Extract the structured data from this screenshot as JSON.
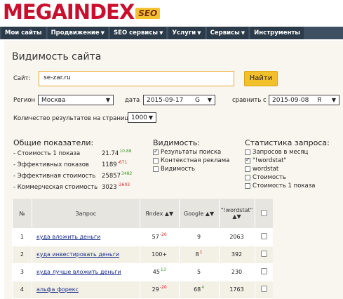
{
  "logo": {
    "text": "MEGAINDEX",
    "badge": "SEO"
  },
  "nav": [
    {
      "label": "Мои сайты",
      "dropdown": false
    },
    {
      "label": "Продвижение",
      "dropdown": true
    },
    {
      "label": "SEO сервисы",
      "dropdown": true
    },
    {
      "label": "Услуги",
      "dropdown": true
    },
    {
      "label": "Сервисы",
      "dropdown": true
    },
    {
      "label": "Инструменты",
      "dropdown": false
    }
  ],
  "page_title": "Видимость сайта",
  "form": {
    "site_label": "Сайт:",
    "site_value": "se-zar.ru",
    "find_button": "Найти",
    "region_label": "Регион",
    "region_value": "Москва",
    "date_label": "дата",
    "date_value": "2015-09-17",
    "date_engine": "G",
    "compare_label": "сравнить с",
    "compare_value": "2015-09-08",
    "compare_engine": "Я",
    "results_label": "Количество результатов на страницу",
    "results_value": "1000"
  },
  "overall": {
    "title": "Общие показатели:",
    "rows": [
      {
        "label": "- Стоимость 1 показа",
        "value": "21.74",
        "delta": "10.88",
        "dir": "up"
      },
      {
        "label": "- Эффективных показов",
        "value": "1189",
        "delta": "-671",
        "dir": "down"
      },
      {
        "label": "- Эффективная стоимость",
        "value": "25857",
        "delta": "3482",
        "dir": "up"
      },
      {
        "label": "- Коммерческая стоимость",
        "value": "3023",
        "delta": "-2603",
        "dir": "down"
      }
    ]
  },
  "visibility": {
    "title": "Видимость:",
    "options": [
      {
        "label": "Результаты поиска",
        "checked": true
      },
      {
        "label": "Контекстная реклама",
        "checked": false
      },
      {
        "label": "Видимость",
        "checked": false
      }
    ]
  },
  "query_stats": {
    "title": "Статистика запроса:",
    "options": [
      {
        "label": "Запросов в месяц",
        "checked": false
      },
      {
        "label": "\"!wordstat\"",
        "checked": true
      },
      {
        "label": "wordstat",
        "checked": false
      },
      {
        "label": "Стоимость",
        "checked": false
      },
      {
        "label": "Стоимость 1 показа",
        "checked": false
      }
    ]
  },
  "table": {
    "headers": {
      "num": "№",
      "query": "Запрос",
      "yandex": "Яndex",
      "google": "Google",
      "wordstat": "\"!wordstat\""
    },
    "rows": [
      {
        "num": "1",
        "query": "куда вложить деньги",
        "yandex": "57",
        "yandex_delta": "-20",
        "yandex_dir": "down",
        "google": "9",
        "google_delta": "",
        "google_dir": "",
        "wordstat": "2063"
      },
      {
        "num": "2",
        "query": "куда инвестировать деньги",
        "yandex": "100+",
        "yandex_delta": "",
        "yandex_dir": "",
        "google": "8",
        "google_delta": "1",
        "google_dir": "down",
        "wordstat": "392"
      },
      {
        "num": "3",
        "query": "куда лучше вложить деньги",
        "yandex": "45",
        "yandex_delta": "13",
        "yandex_dir": "up",
        "google": "5",
        "google_delta": "",
        "google_dir": "",
        "wordstat": "230"
      },
      {
        "num": "4",
        "query": "альфа форекс",
        "yandex": "29",
        "yandex_delta": "-20",
        "yandex_dir": "down",
        "google": "68",
        "google_delta": "4",
        "google_dir": "up",
        "wordstat": "1763"
      }
    ]
  },
  "colors": {
    "brand_red": "#c8102e",
    "accent_yellow": "#f2c02a",
    "nav_bg": "#3d4f60",
    "delta_up": "#3c9a2a",
    "delta_down": "#d42323",
    "link": "#1a2e8a"
  }
}
